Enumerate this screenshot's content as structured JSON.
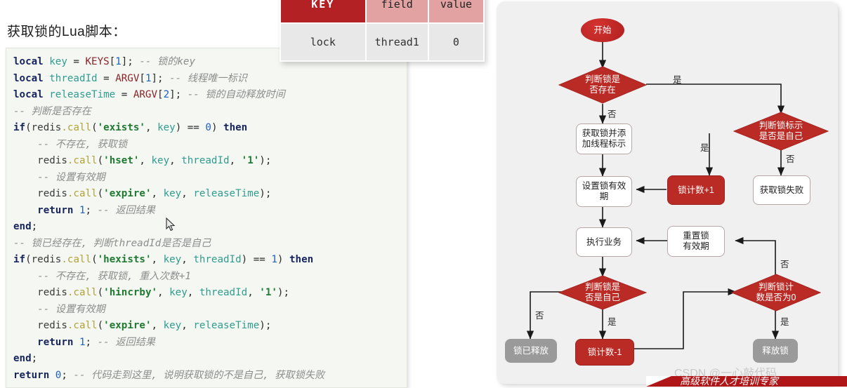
{
  "heading": "获取锁的Lua脚本：",
  "code": {
    "lines": [
      [
        [
          "k",
          "local "
        ],
        [
          "v",
          "key"
        ],
        [
          "o",
          " = "
        ],
        [
          "g",
          "KEYS"
        ],
        [
          "o",
          "["
        ],
        [
          "n",
          "1"
        ],
        [
          "o",
          "]; "
        ],
        [
          "c",
          "-- 锁的key"
        ]
      ],
      [
        [
          "k",
          "local "
        ],
        [
          "v",
          "threadId"
        ],
        [
          "o",
          " = "
        ],
        [
          "g",
          "ARGV"
        ],
        [
          "o",
          "["
        ],
        [
          "n",
          "1"
        ],
        [
          "o",
          "]; "
        ],
        [
          "c",
          "-- 线程唯一标识"
        ]
      ],
      [
        [
          "k",
          "local "
        ],
        [
          "v",
          "releaseTime"
        ],
        [
          "o",
          " = "
        ],
        [
          "g",
          "ARGV"
        ],
        [
          "o",
          "["
        ],
        [
          "n",
          "2"
        ],
        [
          "o",
          "]; "
        ],
        [
          "c",
          "-- 锁的自动释放时间"
        ]
      ],
      [
        [
          "c",
          "-- 判断是否存在"
        ]
      ],
      [
        [
          "k",
          "if"
        ],
        [
          "o",
          "("
        ],
        [
          "r",
          "redis"
        ],
        [
          "f",
          ".call"
        ],
        [
          "o",
          "("
        ],
        [
          "s",
          "'exists'"
        ],
        [
          "o",
          ", "
        ],
        [
          "v",
          "key"
        ],
        [
          "o",
          ") == "
        ],
        [
          "n",
          "0"
        ],
        [
          "o",
          ") "
        ],
        [
          "k",
          "then"
        ]
      ],
      [
        [
          "o",
          "    "
        ],
        [
          "c",
          "-- 不存在, 获取锁"
        ]
      ],
      [
        [
          "o",
          "    "
        ],
        [
          "r",
          "redis"
        ],
        [
          "f",
          ".call"
        ],
        [
          "o",
          "("
        ],
        [
          "s",
          "'hset'"
        ],
        [
          "o",
          ", "
        ],
        [
          "v",
          "key"
        ],
        [
          "o",
          ", "
        ],
        [
          "v",
          "threadId"
        ],
        [
          "o",
          ", "
        ],
        [
          "s",
          "'1'"
        ],
        [
          "o",
          ");"
        ]
      ],
      [
        [
          "o",
          "    "
        ],
        [
          "c",
          "-- 设置有效期"
        ]
      ],
      [
        [
          "o",
          "    "
        ],
        [
          "r",
          "redis"
        ],
        [
          "f",
          ".call"
        ],
        [
          "o",
          "("
        ],
        [
          "s",
          "'expire'"
        ],
        [
          "o",
          ", "
        ],
        [
          "v",
          "key"
        ],
        [
          "o",
          ", "
        ],
        [
          "v",
          "releaseTime"
        ],
        [
          "o",
          ");"
        ]
      ],
      [
        [
          "o",
          "    "
        ],
        [
          "k",
          "return "
        ],
        [
          "n",
          "1"
        ],
        [
          "o",
          "; "
        ],
        [
          "c",
          "-- 返回结果"
        ]
      ],
      [
        [
          "k",
          "end"
        ],
        [
          "o",
          ";"
        ]
      ],
      [
        [
          "c",
          "-- 锁已经存在, 判断threadId是否是自己"
        ]
      ],
      [
        [
          "k",
          "if"
        ],
        [
          "o",
          "("
        ],
        [
          "r",
          "redis"
        ],
        [
          "f",
          ".call"
        ],
        [
          "o",
          "("
        ],
        [
          "s",
          "'hexists'"
        ],
        [
          "o",
          ", "
        ],
        [
          "v",
          "key"
        ],
        [
          "o",
          ", "
        ],
        [
          "v",
          "threadId"
        ],
        [
          "o",
          ") == "
        ],
        [
          "n",
          "1"
        ],
        [
          "o",
          ") "
        ],
        [
          "k",
          "then"
        ]
      ],
      [
        [
          "o",
          "    "
        ],
        [
          "c",
          "-- 不存在, 获取锁, 重入次数+1"
        ]
      ],
      [
        [
          "o",
          "    "
        ],
        [
          "r",
          "redis"
        ],
        [
          "f",
          ".call"
        ],
        [
          "o",
          "("
        ],
        [
          "s",
          "'hincrby'"
        ],
        [
          "o",
          ", "
        ],
        [
          "v",
          "key"
        ],
        [
          "o",
          ", "
        ],
        [
          "v",
          "threadId"
        ],
        [
          "o",
          ", "
        ],
        [
          "s",
          "'1'"
        ],
        [
          "o",
          ");"
        ]
      ],
      [
        [
          "o",
          "    "
        ],
        [
          "c",
          "-- 设置有效期"
        ]
      ],
      [
        [
          "o",
          "    "
        ],
        [
          "r",
          "redis"
        ],
        [
          "f",
          ".call"
        ],
        [
          "o",
          "("
        ],
        [
          "s",
          "'expire'"
        ],
        [
          "o",
          ", "
        ],
        [
          "v",
          "key"
        ],
        [
          "o",
          ", "
        ],
        [
          "v",
          "releaseTime"
        ],
        [
          "o",
          ");"
        ]
      ],
      [
        [
          "o",
          "    "
        ],
        [
          "k",
          "return "
        ],
        [
          "n",
          "1"
        ],
        [
          "o",
          "; "
        ],
        [
          "c",
          "-- 返回结果"
        ]
      ],
      [
        [
          "k",
          "end"
        ],
        [
          "o",
          ";"
        ]
      ],
      [
        [
          "k",
          "return "
        ],
        [
          "n",
          "0"
        ],
        [
          "o",
          "; "
        ],
        [
          "c",
          "-- 代码走到这里, 说明获取锁的不是自己, 获取锁失败"
        ]
      ]
    ]
  },
  "redis_table": {
    "key_header": "KEY",
    "sub_headers": [
      "field",
      "value"
    ],
    "rows": [
      {
        "key": "lock",
        "field": "thread1",
        "value": "0"
      }
    ]
  },
  "flowchart": {
    "nodes": {
      "start": "开始",
      "check_lock_exists": "判断锁是\n否存在",
      "acquire_lock": "获取锁并添\n加线程标示",
      "check_owner": "判断锁标示\n是否是自己",
      "lock_count_plus": "锁计数+1",
      "acquire_fail": "获取锁失败",
      "set_expire": "设置锁有效\n期",
      "run_business": "执行业务",
      "reset_expire": "重置锁\n有效期",
      "check_is_self": "判断锁是\n否是自己",
      "check_count_zero": "判断锁计\n数是否为0",
      "lock_released": "锁已释放",
      "lock_count_minus": "锁计数-1",
      "release_lock": "释放锁"
    },
    "edge_labels": {
      "exists_yes": "是",
      "exists_no": "否",
      "owner_yes": "是",
      "owner_no": "否",
      "is_self_no": "否",
      "is_self_yes": "是",
      "count_zero_no": "否",
      "count_zero_yes": "是"
    },
    "colors": {
      "decision": "#bb2b26",
      "start": "#c22a26",
      "red_box": "#bb2b26",
      "gray_box": "#9a9a9a",
      "panel_bg": "#f0f0f0"
    }
  },
  "watermark": "CSDN @一心敲代码",
  "banner_text": "高级软件人才培训专家"
}
